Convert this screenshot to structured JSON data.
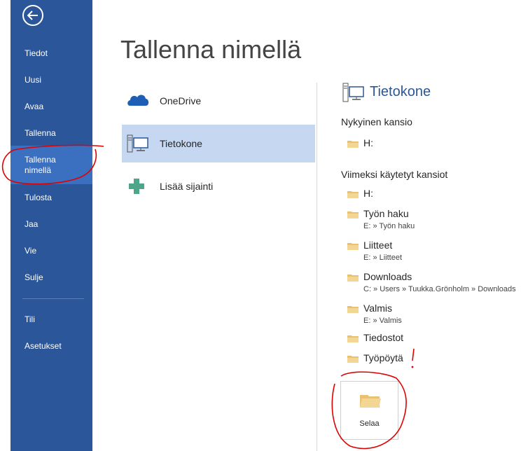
{
  "sidebar": {
    "items": [
      {
        "label": "Tiedot"
      },
      {
        "label": "Uusi"
      },
      {
        "label": "Avaa"
      },
      {
        "label": "Tallenna"
      },
      {
        "label": "Tallenna nimellä",
        "line1": "Tallenna",
        "line2": "nimellä"
      },
      {
        "label": "Tulosta"
      },
      {
        "label": "Jaa"
      },
      {
        "label": "Vie"
      },
      {
        "label": "Sulje"
      },
      {
        "label": "Tili"
      },
      {
        "label": "Asetukset"
      }
    ]
  },
  "page": {
    "title": "Tallenna nimellä"
  },
  "locations": [
    {
      "label": "OneDrive",
      "icon": "cloud-icon"
    },
    {
      "label": "Tietokone",
      "icon": "computer-icon",
      "selected": true
    },
    {
      "label": "Lisää sijainti",
      "icon": "plus-icon"
    }
  ],
  "right_panel": {
    "title": "Tietokone",
    "current_section": "Nykyinen kansio",
    "current_folder": "H:",
    "recent_section": "Viimeksi käytetyt kansiot",
    "recent": [
      {
        "name": "H:",
        "path": ""
      },
      {
        "name": "Työn haku",
        "path": "E: » Työn haku"
      },
      {
        "name": "Liitteet",
        "path": "E: » Liitteet"
      },
      {
        "name": "Downloads",
        "path": "C: » Users » Tuukka.Grönholm » Downloads"
      },
      {
        "name": "Valmis",
        "path": "E: » Valmis"
      },
      {
        "name": "Tiedostot",
        "path": ""
      },
      {
        "name": "Työpöytä",
        "path": ""
      }
    ],
    "browse_label": "Selaa"
  },
  "colors": {
    "sidebar": "#2b579a",
    "selected": "#c5d7f1",
    "accent": "#2b579a",
    "annotation": "#e00000"
  }
}
